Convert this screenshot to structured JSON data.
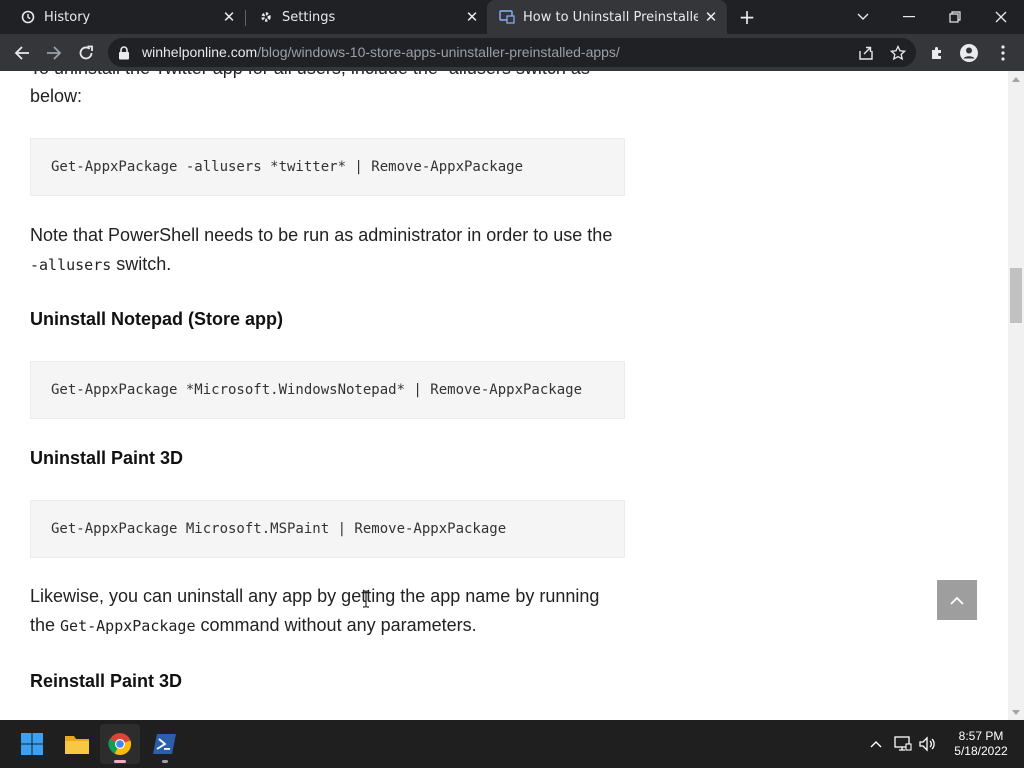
{
  "browser": {
    "tabs": [
      {
        "label": "History",
        "icon": "history-icon",
        "active": false
      },
      {
        "label": "Settings",
        "icon": "gear-icon",
        "active": false
      },
      {
        "label": "How to Uninstall Preinstalled App",
        "icon": "site-favicon-icon",
        "active": true
      }
    ],
    "url_host": "winhelponline.com",
    "url_path": "/blog/windows-10-store-apps-uninstaller-preinstalled-apps/"
  },
  "article": {
    "partial_top_line": "To uninstall the Twitter app for all users, include the -allusers switch as",
    "para1_end": "below:",
    "code1": "Get-AppxPackage -allusers *twitter* | Remove-AppxPackage",
    "note_line1": "Note that PowerShell needs to be run as administrator in order to use the",
    "note_code": "-allusers",
    "note_line2_rest": " switch.",
    "heading_notepad": "Uninstall Notepad (Store app)",
    "code2": "Get-AppxPackage *Microsoft.WindowsNotepad* | Remove-AppxPackage",
    "heading_paint": "Uninstall Paint 3D",
    "code3": "Get-AppxPackage Microsoft.MSPaint | Remove-AppxPackage",
    "likewise_line1": "Likewise, you can uninstall any app by getting the app name by running",
    "likewise_line2_pre": "the ",
    "likewise_code": "Get-AppxPackage",
    "likewise_line2_post": " command without any parameters.",
    "heading_reinstall": "Reinstall Paint 3D"
  },
  "taskbar": {
    "apps": [
      "windows-start-icon",
      "file-explorer-icon",
      "chrome-icon",
      "powershell-icon"
    ],
    "time": "8:57 PM",
    "date": "5/18/2022"
  },
  "colors": {
    "tabstrip": "#202124",
    "toolbar": "#35363a",
    "code_bg": "#f5f5f5",
    "taskbar": "#1f1f1f",
    "backtop": "#9e9e9e"
  }
}
